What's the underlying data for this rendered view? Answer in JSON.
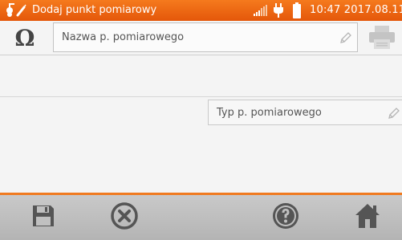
{
  "statusbar": {
    "title": "Dodaj punkt pomiarowy",
    "clock": "10:47 2017.08.11"
  },
  "form": {
    "name_placeholder": "Nazwa p. pomiarowego",
    "type_placeholder": "Typ p. pomiarowego"
  },
  "icons": {
    "app": "measurement-probe-icon",
    "signal": "signal-strength-icon",
    "plug": "power-plug-icon",
    "battery": "battery-icon",
    "omega": "resistance-omega-icon",
    "pencil": "pencil-icon",
    "printer": "printer-icon",
    "save": "save-icon",
    "cancel": "cancel-icon",
    "help": "help-icon",
    "home": "home-icon"
  },
  "colors": {
    "accent": "#f07a1f",
    "statusbar": "#e86414",
    "bottombar": "#bdbdbd",
    "icons": "#555555"
  }
}
